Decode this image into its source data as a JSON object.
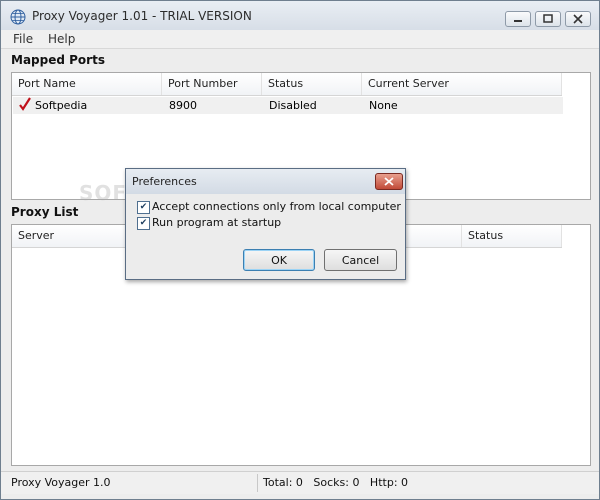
{
  "window": {
    "title": "Proxy Voyager 1.01 - TRIAL VERSION"
  },
  "menu": {
    "items": [
      "File",
      "Help"
    ]
  },
  "mapped_ports": {
    "section_label": "Mapped Ports",
    "columns": [
      "Port Name",
      "Port Number",
      "Status",
      "Current Server"
    ],
    "rows": [
      {
        "name": "Softpedia",
        "port": "8900",
        "status": "Disabled",
        "server": "None",
        "checked": true
      }
    ]
  },
  "proxy_list": {
    "section_label": "Proxy List",
    "columns": [
      "Server",
      "Status"
    ],
    "rows": []
  },
  "statusbar": {
    "app": "Proxy Voyager 1.0",
    "counts": "Total: 0   Socks: 0   Http: 0"
  },
  "watermark": "SOFTPEDIA",
  "preferences_dialog": {
    "title": "Preferences",
    "options": [
      {
        "label": "Accept connections only from local computer",
        "checked": true
      },
      {
        "label": "Run program at startup",
        "checked": true
      }
    ],
    "ok_label": "OK",
    "cancel_label": "Cancel"
  },
  "colors": {
    "check_mark": "#c0101a",
    "close_button": "#c14a38"
  }
}
